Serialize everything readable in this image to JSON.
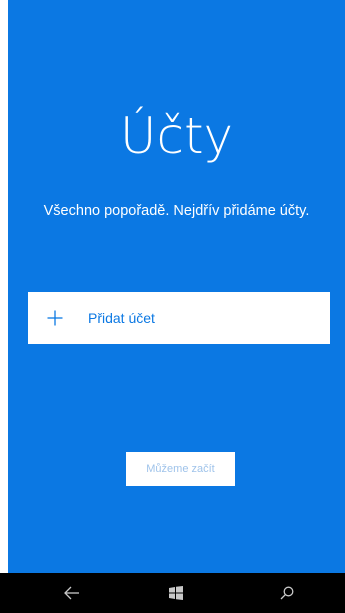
{
  "screen": {
    "title": "Účty",
    "subtitle": "Všechno popořadě. Nejdřív přidáme účty.",
    "add_account": {
      "label": "Přidat účet",
      "icon": "plus-icon"
    },
    "start_button": {
      "label": "Můžeme začít",
      "enabled": false
    }
  },
  "navbar": {
    "back_icon": "back-arrow-icon",
    "home_icon": "windows-logo-icon",
    "search_icon": "search-icon"
  },
  "colors": {
    "accent": "#0b78e3",
    "background": "#0b78e3",
    "button_bg": "#ffffff",
    "disabled_text": "#9fc3ea",
    "navbar_bg": "#000000",
    "navbar_icon": "#c8c8c8"
  }
}
